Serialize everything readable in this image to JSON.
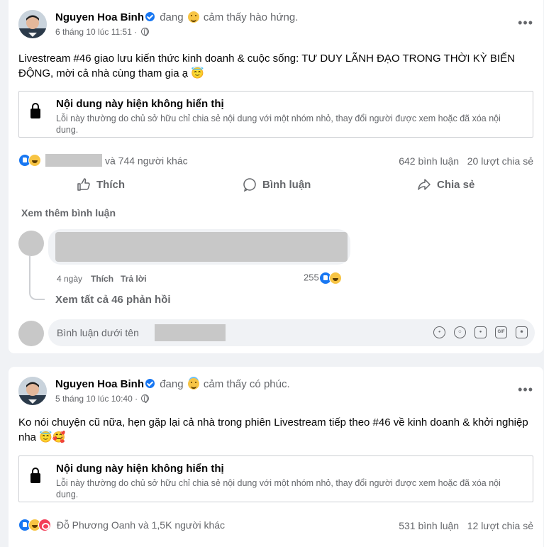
{
  "posts": [
    {
      "author": "Nguyen Hoa Binh",
      "feeling_prefix": "đang",
      "feeling": "cảm thấy hào hứng.",
      "feeling_icon": "grinning-face-icon",
      "date": "6 tháng 10 lúc 11:51 ·",
      "text": "Livestream #46 giao lưu kiến thức kinh doanh & cuộc sống: TƯ DUY LÃNH ĐẠO TRONG THỜI KỲ BIẾN ĐỘNG, mời cả nhà cùng tham gia ạ 😇",
      "unavailable": {
        "title": "Nội dung này hiện không hiển thị",
        "desc": "Lỗi này thường do chủ sở hữu chỉ chia sẻ nội dung với một nhóm nhỏ, thay đổi người được xem hoặc đã xóa nội dung."
      },
      "reactions_text": "và 744 người khác",
      "comments": "642 bình luận",
      "shares": "20 lượt chia sẻ"
    },
    {
      "author": "Nguyen Hoa Binh",
      "feeling_prefix": "đang",
      "feeling": "cảm thấy có phúc.",
      "feeling_icon": "smiling-face-with-halo-icon",
      "date": "5 tháng 10 lúc 10:40 ·",
      "text": "Ko nói chuyện cũ nữa, hẹn gặp lại cả nhà trong phiên Livestream tiếp theo #46 về kinh doanh & khởi nghiệp nha 😇🥰",
      "unavailable": {
        "title": "Nội dung này hiện không hiển thị",
        "desc": "Lỗi này thường do chủ sở hữu chỉ chia sẻ nội dung với một nhóm nhỏ, thay đổi người được xem hoặc đã xóa nội dung."
      },
      "reactions_text": "Đỗ Phương Oanh và 1,5K người khác",
      "comments": "531 bình luận",
      "shares": "12 lượt chia sẻ"
    }
  ],
  "actions": {
    "like": "Thích",
    "comment": "Bình luận",
    "share": "Chia sẻ"
  },
  "comment_section": {
    "see_more": "Xem thêm bình luận",
    "comment_time": "4 ngày",
    "comment_like": "Thích",
    "comment_reply": "Trả lời",
    "comment_reaction_count": "255",
    "view_replies": "Xem tất cả 46 phản hồi",
    "composer_placeholder": "Bình luận dưới tên",
    "composer_icons": [
      "avatar-sticker-icon",
      "emoji-icon",
      "camera-icon",
      "gif-icon",
      "sticker-icon"
    ]
  },
  "colors": {
    "background": "#f0f2f5",
    "card": "#ffffff",
    "secondary_text": "#65676b",
    "like_blue": "#1877f2",
    "love_red": "#f33e58"
  }
}
